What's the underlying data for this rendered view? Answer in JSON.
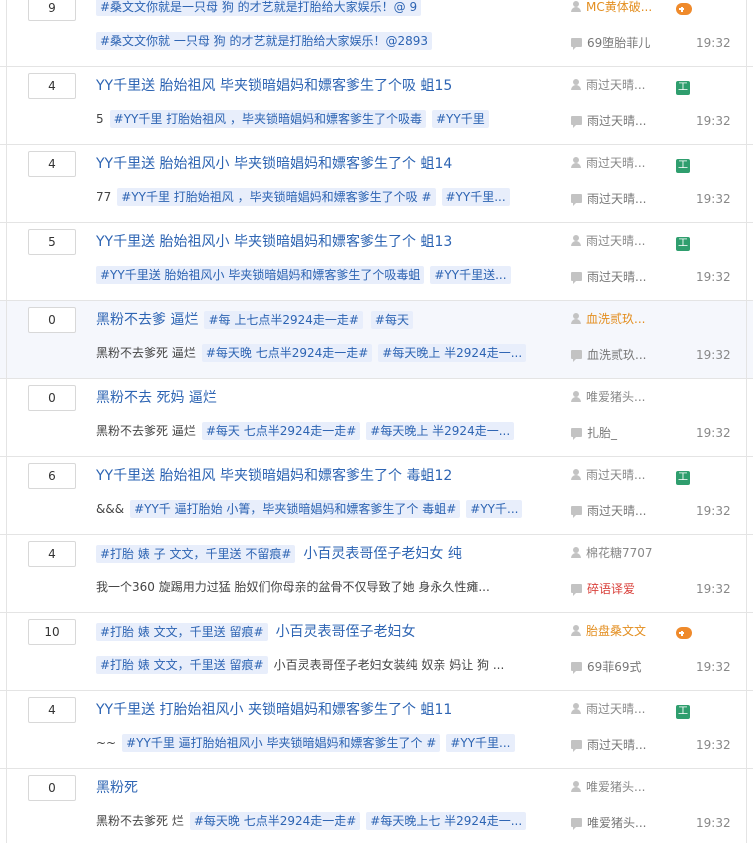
{
  "threads": [
    {
      "reply_count": "9",
      "title": "",
      "title_tags": [
        "#桑文文你就是一只母 狗 的才艺就是打胎给大家娱乐！@ 9"
      ],
      "abstract_lead": "",
      "abstract_tags": [
        "#桑文文你就 一只母 狗 的才艺就是打胎给大家娱乐！@2893"
      ],
      "badge_icon": "game-icon",
      "author": "MC黄体破...",
      "author_color": "orange",
      "last_replier": "69堕胎菲儿",
      "replier_color": "",
      "time": "19:32",
      "alt": false
    },
    {
      "reply_count": "4",
      "title": "YY千里送 胎始祖风 毕夹锁暗娼妈和嫖客爹生了个吸 蛆15",
      "title_tags": [],
      "abstract_lead": "5",
      "abstract_tags": [
        "#YY千里 打胎始祖风 ，毕夹锁暗娼妈和嫖客爹生了个吸毒",
        "#YY千里"
      ],
      "badge_icon": "jing-icon",
      "author": "雨过天晴...",
      "author_color": "",
      "last_replier": "雨过天晴...",
      "replier_color": "",
      "time": "19:32",
      "alt": false
    },
    {
      "reply_count": "4",
      "title": "YY千里送 胎始祖风小 毕夹锁暗娼妈和嫖客爹生了个 蛆14",
      "title_tags": [],
      "abstract_lead": "77",
      "abstract_tags": [
        "#YY千里 打胎始祖风 ，毕夹锁暗娼妈和嫖客爹生了个吸 #",
        "#YY千里..."
      ],
      "badge_icon": "jing-icon",
      "author": "雨过天晴...",
      "author_color": "",
      "last_replier": "雨过天晴...",
      "replier_color": "",
      "time": "19:32",
      "alt": false
    },
    {
      "reply_count": "5",
      "title": "YY千里送 胎始祖风小 毕夹锁暗娼妈和嫖客爹生了个 蛆13",
      "title_tags": [],
      "abstract_lead": "",
      "abstract_tags": [
        "#YY千里送 胎始祖风小 毕夹锁暗娼妈和嫖客爹生了个吸毒蛆",
        "#YY千里送..."
      ],
      "badge_icon": "jing-icon",
      "author": "雨过天晴...",
      "author_color": "",
      "last_replier": "雨过天晴...",
      "replier_color": "",
      "time": "19:32",
      "alt": false
    },
    {
      "reply_count": "0",
      "title": "黑粉不去爹 逼烂",
      "title_tags": [
        "#每 上七点半2924走一走#",
        "#每天"
      ],
      "abstract_lead": "黑粉不去爹死 逼烂",
      "abstract_tags": [
        "#每天晚 七点半2924走一走#",
        "#每天晚上 半2924走一..."
      ],
      "badge_icon": "",
      "author": "血洗贰玖...",
      "author_color": "orange",
      "last_replier": "血洗贰玖...",
      "replier_color": "",
      "time": "19:32",
      "alt": true
    },
    {
      "reply_count": "0",
      "title": "黑粉不去 死妈 逼烂",
      "title_tags": [],
      "abstract_lead": "黑粉不去爹死 逼烂",
      "abstract_tags": [
        "#每天 七点半2924走一走#",
        "#每天晚上 半2924走一..."
      ],
      "badge_icon": "",
      "author": "唯爱猪头...",
      "author_color": "",
      "last_replier": "扎胎_",
      "replier_color": "",
      "time": "19:32",
      "alt": false
    },
    {
      "reply_count": "6",
      "title": "YY千里送 胎始祖风 毕夹锁暗娼妈和嫖客爹生了个 毒蛆12",
      "title_tags": [],
      "abstract_lead": "&&&",
      "abstract_tags": [
        "#YY千 逼打胎始 小箐，毕夹锁暗娼妈和嫖客爹生了个 毒蛆#",
        "#YY千..."
      ],
      "badge_icon": "jing-icon",
      "author": "雨过天晴...",
      "author_color": "",
      "last_replier": "雨过天晴...",
      "replier_color": "",
      "time": "19:32",
      "alt": false
    },
    {
      "reply_count": "4",
      "title": "",
      "title_tags": [
        "#打胎 婊 子 文文，千里送 不留痕#"
      ],
      "title_after": "小百灵表哥侄子老妇女 纯",
      "abstract_lead": "我一个360 旋踢用力过猛 胎奴们你母亲的盆骨不仅导致了她 身永久性瘫...",
      "abstract_tags": [],
      "badge_icon": "",
      "author": "棉花糖7707",
      "author_color": "",
      "last_replier": "碎语译爱",
      "replier_color": "red",
      "time": "19:32",
      "alt": false
    },
    {
      "reply_count": "10",
      "title": "",
      "title_tags": [
        "#打胎 婊 文文，千里送 留痕#"
      ],
      "title_after": "小百灵表哥侄子老妇女",
      "abstract_lead": "",
      "abstract_tags": [
        "#打胎 婊 文文，千里送 留痕#"
      ],
      "abstract_after": "小百灵表哥侄子老妇女装纯 奴亲 妈让 狗 ...",
      "badge_icon": "game-icon",
      "author": "胎盘桑文文",
      "author_color": "orange",
      "last_replier": "69菲69式",
      "replier_color": "",
      "time": "19:32",
      "alt": false
    },
    {
      "reply_count": "4",
      "title": "YY千里送 打胎始祖风小 夹锁暗娼妈和嫖客爹生了个 蛆11",
      "title_tags": [],
      "abstract_lead": "~~",
      "abstract_tags": [
        "#YY千里 逼打胎始祖风小 毕夹锁暗娼妈和嫖客爹生了个 #",
        "#YY千里..."
      ],
      "badge_icon": "jing-icon",
      "author": "雨过天晴...",
      "author_color": "",
      "last_replier": "雨过天晴...",
      "replier_color": "",
      "time": "19:32",
      "alt": false
    },
    {
      "reply_count": "0",
      "title": "黑粉死",
      "title_tags": [],
      "abstract_lead": "黑粉不去爹死 烂",
      "abstract_tags": [
        "#每天晚 七点半2924走一走#",
        "#每天晚上七 半2924走一..."
      ],
      "badge_icon": "",
      "author": "唯爱猪头...",
      "author_color": "",
      "last_replier": "唯爱猪头...",
      "replier_color": "",
      "time": "19:32",
      "alt": false
    }
  ]
}
